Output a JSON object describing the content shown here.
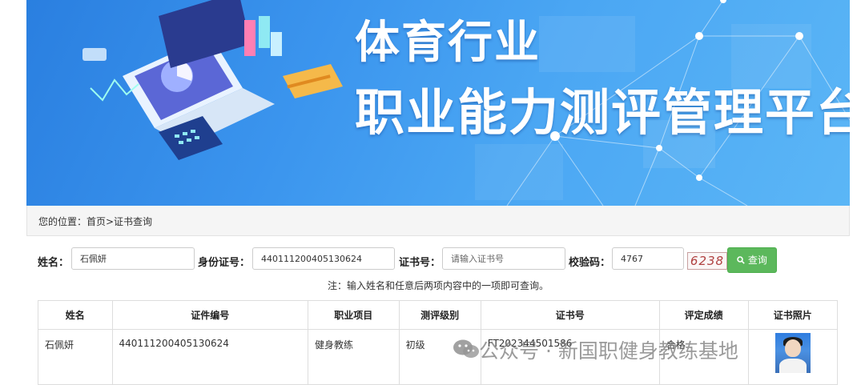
{
  "banner": {
    "title_line1": "体育行业",
    "title_line2": "职业能力测评管理平台"
  },
  "breadcrumb": "您的位置：首页>证书查询",
  "form": {
    "name_label": "姓名：",
    "name_value": "石佩妍",
    "id_label": "身份证号：",
    "id_value": "440111200405130624",
    "cert_label": "证书号：",
    "cert_placeholder": "请输入证书号",
    "code_label": "校验码：",
    "code_value": "4767",
    "captcha_text": "6238",
    "search_button": "查询",
    "search_icon": "search-icon"
  },
  "note": "注：输入姓名和任意后两项内容中的一项即可查询。",
  "table": {
    "headers": [
      "姓名",
      "证件编号",
      "职业项目",
      "测评级别",
      "证书号",
      "评定成绩",
      "证书照片"
    ],
    "rows": [
      {
        "name": "石佩妍",
        "id": "440111200405130624",
        "project": "健身教练",
        "level": "初级",
        "cert": "FT202344501586",
        "score": "合格"
      }
    ]
  },
  "watermark": "公众号 · 新国职健身教练基地",
  "colors": {
    "banner": "#3b95ee",
    "button": "#5cb85c",
    "captcha": "#b04040"
  }
}
